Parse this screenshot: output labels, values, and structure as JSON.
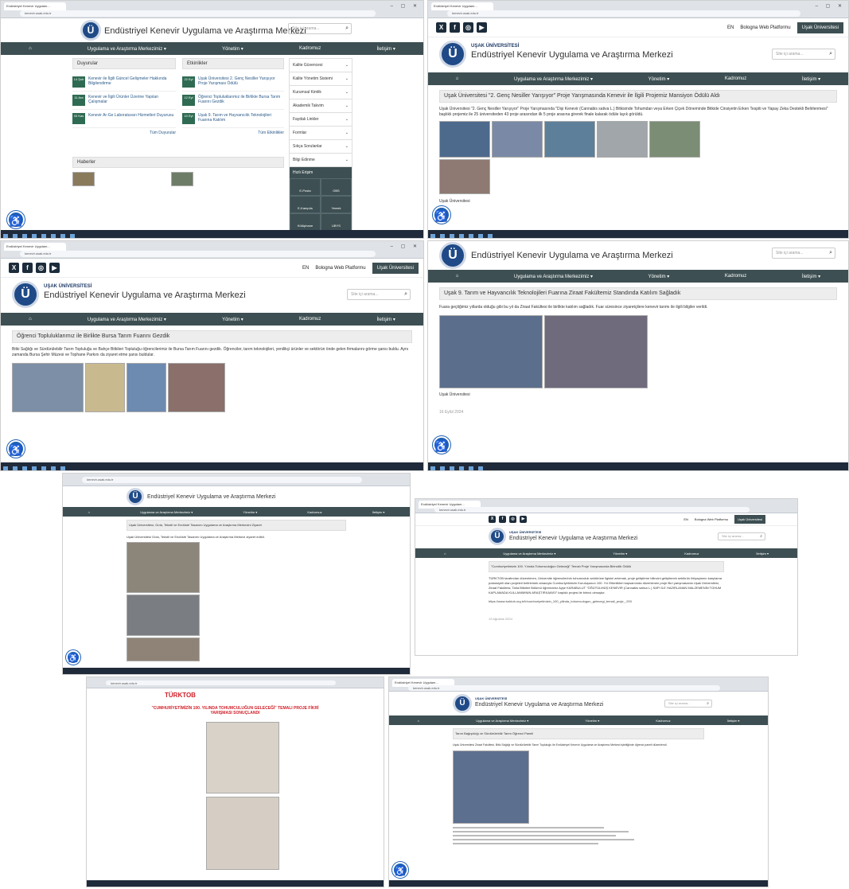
{
  "site": {
    "org_small": "UŞAK ÜNİVERSİTESİ",
    "org_name": "Endüstriyel Kenevir Uygulama ve Araştırma Merkezi",
    "logo_letter": "Ü",
    "search_placeholder": "Site içi arama...",
    "top_links": {
      "en": "EN",
      "bologna": "Bologna Web Platformu",
      "uni": "Uşak Üniversitesi"
    },
    "nav": [
      "Uygulama ve Araştırma Merkezimiz ▾",
      "Yönetim ▾",
      "Kadromuz",
      "İletişim ▾"
    ]
  },
  "tab": "Endüstriyel Kenevir Uygulam...",
  "url": "kenevir.usak.edu.tr",
  "panel1": {
    "col1_title": "Duyurular",
    "col2_title": "Etkinlikler",
    "announcements": [
      {
        "date": "14 Şub",
        "text": "Kenevir ile İlgili Güncel Gelişmeler Hakkında Bilgilendirme"
      },
      {
        "date": "11 Ara",
        "text": "Kenevir ve İlgili Ürünler Üzerine Yapılan Çalışmalar"
      },
      {
        "date": "03 Kas",
        "text": "Kenevir Ar-Ge Laboratuvarı Hizmetleri Duyurusu"
      }
    ],
    "events": [
      {
        "date": "22 Eyl",
        "text": "Uşak Üniversitesi 2. Genç Nesiller Yarışıyor Proje Yarışması Ödülü"
      },
      {
        "date": "12 Eyl",
        "text": "Öğrenci Topluluklarımız ile Birlikte Bursa Tarım Fuarını Gezdik"
      },
      {
        "date": "10 Eyl",
        "text": "Uşak 9. Tarım ve Hayvancılık Teknolojileri Fuarına Katılım"
      }
    ],
    "all_announcements": "Tüm Duyurular",
    "all_events": "Tüm Etkinlikler",
    "news_title": "Haberler",
    "side_menu": [
      "Kalite Güvencesi",
      "Kalite Yönetim Sistemi",
      "Kurumsal Kimlik",
      "Akademik Takvim",
      "Faydalı Linkler",
      "Formlar",
      "Sıkça Sorulanlar",
      "Bilgi Edinme"
    ],
    "quick_title": "Hızlı Erişim",
    "quick_links": [
      "E-Posta",
      "OBS",
      "E-Kampüs",
      "Yemek",
      "Kütüphane",
      "UBYS"
    ]
  },
  "panel2": {
    "title": "Uşak Üniversitesi \"2. Genç Nesiller Yarışıyor\" Proje Yarışmasında Kenevir ile İlgili Projemiz Mansiyon Ödülü Aldı",
    "body": "Uşak Üniversitesi \"2. Genç Nesiller Yarışıyor\" Proje Yarışmasında \"Dişi Kenevir (Cannabis sativa L.) Bitkisinde Tohumdan veya Erken Çiçek Döneminde Bitkide Cinsiyetin Erken Tespiti ve Yapay Zeka Destekli Belirlenmesi\" başlıklı projemiz ile 25 üniversiteden 43 proje arasından ilk 5 proje arasına girerek finale kalarak ödüle layık görüldü.",
    "footer": "Uşak Üniversitesi"
  },
  "panel3": {
    "title": "Öğrenci Topluluklarımız ile Birlikte Bursa Tarım Fuarını Gezdik",
    "body": "Bitki Sağlığı ve Sürdürülebilir Tarım Topluluğu ve Bahçe Bitkileri Topluluğu öğrencilerimiz ile Bursa Tarım Fuarını gezdik. Öğrenciler, tarım teknolojileri, yenilikçi ürünler ve sektörün önde gelen firmalarını görme şansı buldu. Aynı zamanda Bursa Şehir Müzesi ve Tophane Parkını da ziyaret etme şansı buldular."
  },
  "panel4": {
    "title": "Uşak 9. Tarım ve Hayvancılık Teknolojileri Fuarına Ziraat Fakültemiz Standında Katılım Sağladık",
    "body": "Fuara geçtiğimiz yıllarda olduğu gibi bu yıl da Ziraat Fakültesi ile birlikte katılım sağladık. Fuar süresince ziyaretçilere kenevir tarımı ile ilgili bilgiler verildi.",
    "footer": "Uşak Üniversitesi",
    "date": "16 Eylül 2024"
  },
  "panel5": {
    "title": "Uşak Üniversitesi, Gıda, Tekstil ve Endüstri Tasarımı Uygulama ve Araştırma Merkezini Ziyaret",
    "body": "Uşak Üniversitesi Gıda, Tekstil ve Endüstri Tasarımı Uygulama ve Araştırma Merkezi ziyaret edildi."
  },
  "panel6": {
    "title": "\"Cumhuriyetimizin 100. Yılında Tohumculuğun Geleceği\" Temalı Proje Yarışmasında Birincilik Ödülü",
    "body": "TÜRKTOB tarafından düzenlenen, Üniversite öğrencilerinin tohumculuk sektörüne ilgisini artırmak, proje geliştirme bilincini geliştirmek sektörün ihtiyaçlarını karşılama potansiyeli olan projeleri belirlemek amacıyla Cumhuriyetimizin Kuruluşunun 100. Yılı Etkinlikleri kapsamında düzenlenen proje fikri yarışmasında Uşak Üniversitesi, Ziraat Fakültesi, Tarla Bitkileri Bölümü öğrencimiz Ayşe KARABULUT \"ÖĞÜTÜLMÜŞ KENEVİR (Cannabis sativa L.) SAPI İLE HAZIRLANAN MALZEMENİN TOHUM KAPLAMADA KULLANIMININ ARAŞTIRILMASI\" başlıklı projesi ile birinci olmuştur.",
    "link": "https://www.turktob.org.tr/tr/cumhuriyetimizin_100_yilinda_tohumculugun_gelecegi_temali_proje_-293",
    "date": "13 Ağustos 2024"
  },
  "panel7": {
    "title": "\"CUMHURİYETİMİZİN 100. YILINDA TOHUMCULUĞUN GELECEĞİ\" TEMALI PROJE FİKRİ YARIŞMASI SONUÇLANDI",
    "brand": "TÜRKTOB"
  },
  "panel8": {
    "title": "Tarım Bağışıklığı ve Sürdürülebilir Tarım Öğrenci Paneli",
    "body": "Uşak Üniversitesi Ziraat Fakültesi, Bitki Sağlığı ve Sürdürülebilir Tarım Topluluğu ile Endüstriyel Kenevir Uygulama ve Araştırma Merkezi işbirliğinde öğrenci paneli düzenlendi."
  }
}
